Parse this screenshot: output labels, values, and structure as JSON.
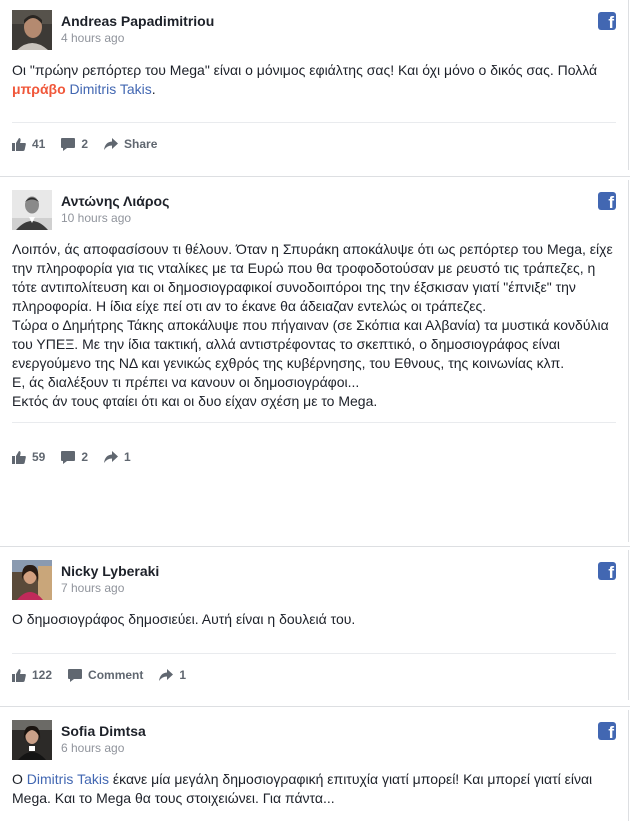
{
  "comments": [
    {
      "author": "Andreas Papadimitriou",
      "time": "4 hours ago",
      "text_a": "Οι \"πρώην ρεπόρτερ του Mega\" είναι ο μόνιμος εφιάλτης σας! Και όχι μόνο ο δικός σας. Πολλά",
      "text_hot": "μπράβο",
      "text_link": "Dimitris Takis",
      "text_b": ".",
      "likes": "41",
      "replies": "2",
      "share_label": "Share"
    },
    {
      "author": "Αντώνης Λιάρος",
      "time": "10 hours ago",
      "lines": [
        "Λοιπόν, άς αποφασίσουν τι θέλουν. Όταν η Σπυράκη αποκάλυψε ότι ως ρεπόρτερ του Mega, είχε την πληροφορία για τις νταλίκες με τα Ευρώ που θα τροφοδοτούσαν με ρευστό τις τράπεζες, η τότε αντιπολίτευση και οι δημοσιογραφικοί συνοδοιπόροι της την έξσκισαν γιατί \"έπνιξε\" την πληροφορία. Η ίδια είχε πεί οτι αν το έκανε θα άδειαζαν εντελώς οι τράπεζες.",
        "Τώρα ο Δημήτρης Τάκης αποκάλυψε που πήγαιναν (σε Σκόπια και Αλβανία) τα μυστικά κονδύλια του ΥΠΕΞ. Με την ίδια τακτική, αλλά αντιστρέφοντας το σκεπτικό, ο δημοσιογράφος είναι ενεργούμενο της ΝΔ και γενικώς εχθρός της κυβέρνησης, του Εθνους, της κοινωνίας κλπ.",
        "Ε, άς διαλέξουν τι πρέπει να κανουν οι δημοσιογράφοι...",
        "Εκτός άν τους φταίει ότι και οι δυο είχαν σχέση με το Mega."
      ],
      "likes": "59",
      "replies": "2",
      "shares": "1"
    },
    {
      "author": "Nicky Lyberaki",
      "time": "7 hours ago",
      "text": "Ο δημοσιογράφος δημοσιεύει. Αυτή είναι η δουλειά του.",
      "likes": "122",
      "comment_label": "Comment",
      "shares": "1"
    },
    {
      "author": "Sofia Dimtsa",
      "time": "6 hours ago",
      "text_a": "Ο",
      "text_link": "Dimitris Takis",
      "text_b": "έκανε μία μεγάλη δημοσιογραφική επιτυχία γιατί μπορεί! Και μπορεί γιατί είναι Mega. Και το Mega θα τους στοιχειώνει. Για πάντα..."
    }
  ],
  "colors": {
    "link": "#4267b2",
    "highlight": "#f0573a",
    "facebook": "#4267b2",
    "meta": "#90949c"
  }
}
